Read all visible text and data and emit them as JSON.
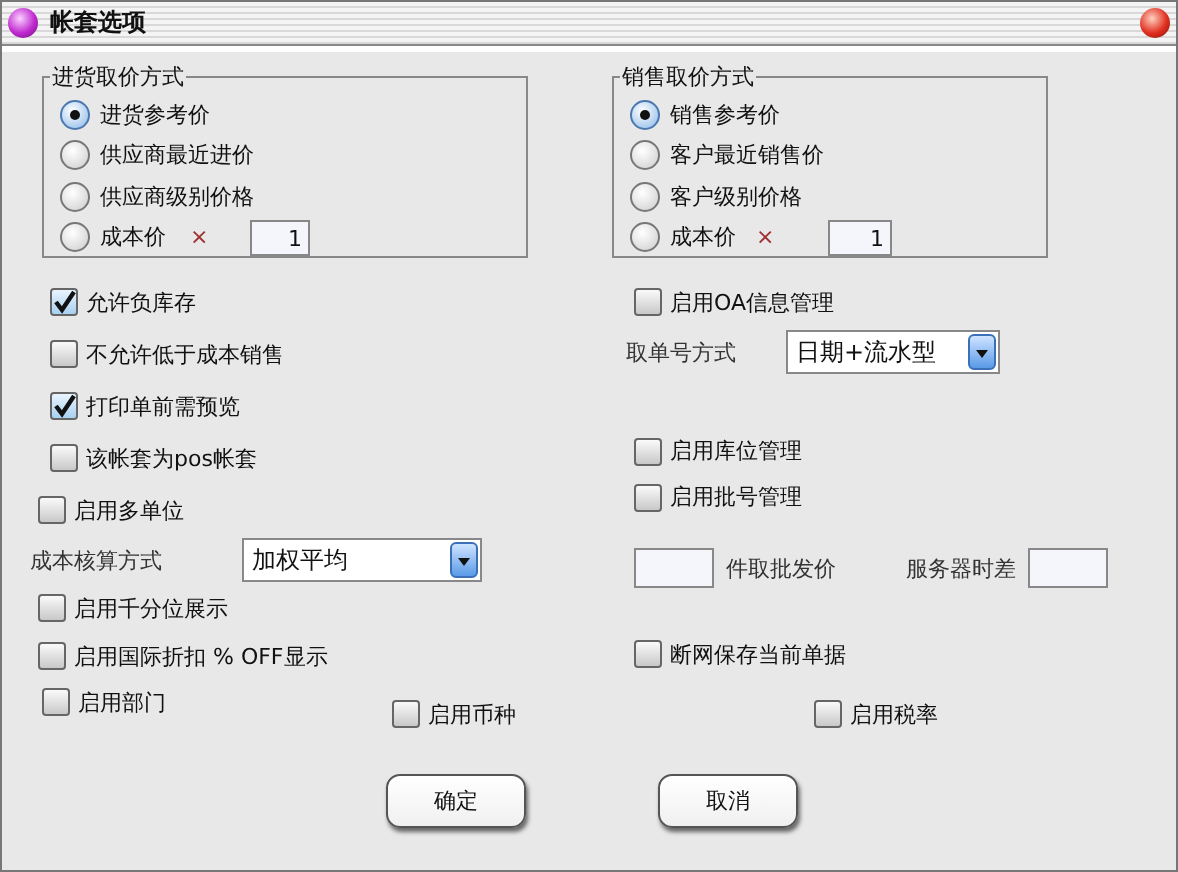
{
  "window": {
    "title": "帐套选项"
  },
  "purchase_group": {
    "title": "进货取价方式",
    "options": [
      {
        "label": "进货参考价",
        "selected": true
      },
      {
        "label": "供应商最近进价",
        "selected": false
      },
      {
        "label": "供应商级别价格",
        "selected": false
      },
      {
        "label": "成本价",
        "selected": false,
        "sign": "×",
        "value": "1"
      }
    ]
  },
  "sales_group": {
    "title": "销售取价方式",
    "options": [
      {
        "label": "销售参考价",
        "selected": true
      },
      {
        "label": "客户最近销售价",
        "selected": false
      },
      {
        "label": "客户级别价格",
        "selected": false
      },
      {
        "label": "成本价",
        "selected": false,
        "sign": "×",
        "value": "1"
      }
    ]
  },
  "left_options": [
    {
      "kind": "checkbox",
      "label": "允许负库存",
      "checked": true
    },
    {
      "kind": "checkbox",
      "label": "不允许低于成本销售",
      "checked": false
    },
    {
      "kind": "checkbox",
      "label": "打印单前需预览",
      "checked": true
    },
    {
      "kind": "checkbox",
      "label": "该帐套为pos帐套",
      "checked": false
    },
    {
      "kind": "checkbox",
      "label": "启用多单位",
      "checked": false
    },
    {
      "kind": "select",
      "label": "成本核算方式",
      "value": "加权平均"
    },
    {
      "kind": "checkbox",
      "label": "启用千分位展示",
      "checked": false
    },
    {
      "kind": "checkbox",
      "label": "启用国际折扣 % OFF显示",
      "checked": false
    }
  ],
  "right_options": [
    {
      "kind": "checkbox",
      "label": "启用OA信息管理",
      "checked": false
    },
    {
      "kind": "select",
      "label": "取单号方式",
      "value": "日期+流水型"
    },
    {
      "kind": "checkbox",
      "label": "启用库位管理",
      "checked": false
    },
    {
      "kind": "checkbox",
      "label": "启用批号管理",
      "checked": false
    },
    {
      "kind": "fields",
      "label": "件取批发价",
      "label_2": "服务器时差"
    },
    {
      "kind": "checkbox",
      "label": "断网保存当前单据",
      "checked": false
    }
  ],
  "bottom_options": [
    {
      "label": "启用部门",
      "checked": false
    },
    {
      "label": "启用币种",
      "checked": false
    },
    {
      "label": "启用税率",
      "checked": false
    }
  ],
  "buttons": [
    "确定",
    "取消"
  ]
}
